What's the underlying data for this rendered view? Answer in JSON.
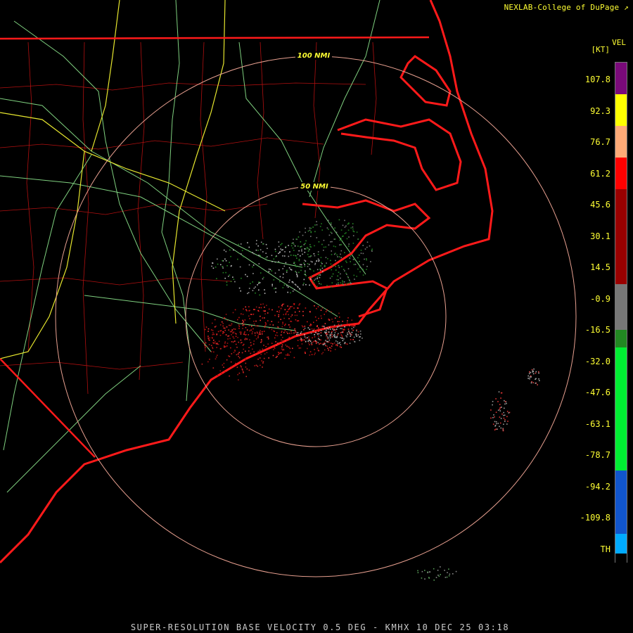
{
  "credit": "NEXLAB-College of DuPage",
  "footer": "SUPER-RESOLUTION BASE VELOCITY 0.5 DEG - KMHX 10 DEC 25 03:18",
  "legend": {
    "title": "VEL",
    "unit": "[KT]",
    "ticks": [
      "107.8",
      "92.3",
      "76.7",
      "61.2",
      "45.6",
      "30.1",
      "14.5",
      "-0.9",
      "-16.5",
      "-32.0",
      "-47.6",
      "-63.1",
      "-78.7",
      "-94.2",
      "-109.8",
      "TH"
    ],
    "colors": [
      "#7a0a7a",
      "#ffff00",
      "#ffaa77",
      "#ff0000",
      "#990000",
      "#777777",
      "#228822",
      "#00ee33",
      "#1155cc",
      "#00aaff",
      "#000000"
    ]
  },
  "rings": {
    "inner_label": "50 NMI",
    "outer_label": "100 NMI"
  },
  "colors": {
    "coast": "#ff1a1a",
    "county": "#cc1818",
    "road": "#88dd88",
    "interstate": "#eeee33",
    "ring": "#e8a090"
  }
}
